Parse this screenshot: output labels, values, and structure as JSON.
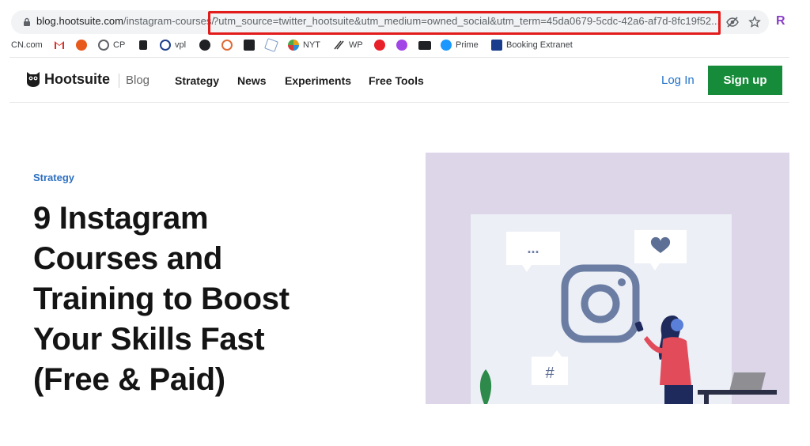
{
  "browser": {
    "url_host": "blog.hootsuite.com",
    "url_path": "/instagram-courses/",
    "url_query": "?utm_source=twitter_hootsuite&utm_medium=owned_social&utm_term=45da0679-5cdc-42a6-af7d-8fc19f52...",
    "profile_initial": "R"
  },
  "bookmarks": [
    {
      "label": "CN.com",
      "icon": "cn-icon"
    },
    {
      "label": "",
      "icon": "gmail-icon",
      "color": "#d93025"
    },
    {
      "label": "",
      "icon": "duckduckgo-icon",
      "color": "#e8591c"
    },
    {
      "label": "CP",
      "icon": "globe-icon",
      "color": "#5f6368"
    },
    {
      "label": "",
      "icon": "shield-icon",
      "color": "#202124"
    },
    {
      "label": "vpl",
      "icon": "vpl-icon",
      "color": "#1f3f8c"
    },
    {
      "label": "",
      "icon": "t-icon",
      "color": "#202124"
    },
    {
      "label": "",
      "icon": "swirl-icon",
      "color": "#e06b36"
    },
    {
      "label": "",
      "icon": "square-icon",
      "color": "#202124"
    },
    {
      "label": "",
      "icon": "bookmark-icon",
      "color": "#7a9cc6"
    },
    {
      "label": "NYT",
      "icon": "pinwheel-icon",
      "color": "#e2a21a"
    },
    {
      "label": "WP",
      "icon": "wp-icon",
      "color": "#333333"
    },
    {
      "label": "",
      "icon": "red-circle-icon",
      "color": "#e8202a"
    },
    {
      "label": "",
      "icon": "messenger-icon",
      "color": "#a245e6"
    },
    {
      "label": "",
      "icon": "bbc-icon",
      "color": "#202124"
    },
    {
      "label": "Prime",
      "icon": "prime-icon",
      "color": "#1a98ff"
    },
    {
      "label": "Booking Extranet",
      "icon": "booking-icon",
      "color": "#1a3c8c"
    }
  ],
  "header": {
    "logo": "Hootsuite",
    "blog": "Blog",
    "nav": [
      "Strategy",
      "News",
      "Experiments",
      "Free Tools"
    ],
    "login": "Log In",
    "signup": "Sign up"
  },
  "article": {
    "category": "Strategy",
    "headline": [
      "9 Instagram",
      "Courses and",
      "Training to Boost",
      "Your Skills Fast",
      "(Free & Paid)"
    ],
    "art_hash": "#",
    "art_dots": "..."
  },
  "colors": {
    "signup_bg": "#168b3a",
    "link_blue": "#1f73c9",
    "highlight_red": "#e21b1b",
    "art_bg": "#dcd6e8"
  }
}
